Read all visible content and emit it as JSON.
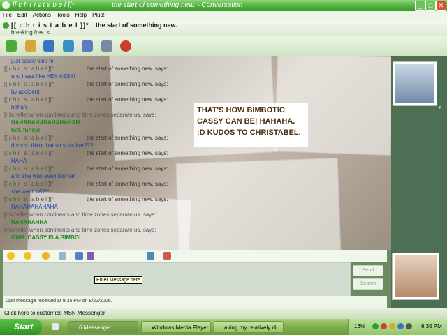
{
  "window": {
    "title_name": "[[ c h r i s t a b e l ]]*",
    "title_conv": "the start of something new. - Conversation",
    "controls": [
      "_",
      "□",
      "✕"
    ]
  },
  "menu": [
    "File",
    "Edit",
    "Actions",
    "Tools",
    "Help",
    "Plus!"
  ],
  "header": {
    "name": "[[ c h r i s t a b e l ]]*",
    "name_suffix": "the start of something new.",
    "personal_message": "breaking free. <"
  },
  "toolbar_icons": [
    "invite-icon",
    "send-files-icon",
    "webcam-icon",
    "call-icon",
    "activities-icon",
    "games-icon",
    "block-icon"
  ],
  "chat": [
    {
      "type": "msg",
      "text": "just cassy said hi"
    },
    {
      "type": "who",
      "text": "[[ c h r i s t a b e l ]]*",
      "says": "the start of something new. says:"
    },
    {
      "type": "msg",
      "text": "and i was like HEY ASSY!"
    },
    {
      "type": "who",
      "text": "[[ c h r i s t a b e l ]]*",
      "says": "the start of something new. says:"
    },
    {
      "type": "msg",
      "text": "by accident"
    },
    {
      "type": "who",
      "text": "[[ c h r i s t a b e l ]]*",
      "says": "the start of something new. says:"
    },
    {
      "type": "msg",
      "text": "hahah"
    },
    {
      "type": "who",
      "text": "[michelle] when continents and time zones separate us. says:"
    },
    {
      "type": "green",
      "text": "HAHAHAHAHAHAHAHAH"
    },
    {
      "type": "green",
      "text": "fatt. funny!"
    },
    {
      "type": "who",
      "text": "[[ c h r i s t a b e l ]]*",
      "says": "the start of something new. says:"
    },
    {
      "type": "msg",
      "text": "doncho think that so suits her???"
    },
    {
      "type": "who",
      "text": "[[ c h r i s t a b e l ]]*",
      "says": "the start of something new. says:"
    },
    {
      "type": "msg",
      "text": "HAHA"
    },
    {
      "type": "who",
      "text": "[[ c h r i s t a b e l ]]*",
      "says": "the start of something new. says:"
    },
    {
      "type": "msg",
      "text": "and she was even funnier"
    },
    {
      "type": "who",
      "text": "[[ c h r i s t a b e l ]]*",
      "says": "the start of something new. says:"
    },
    {
      "type": "msg",
      "text": "she went YAYY!"
    },
    {
      "type": "who",
      "text": "[[ c h r i s t a b e l ]]*",
      "says": "the start of something new. says:"
    },
    {
      "type": "msg",
      "text": "HAHAHAHAHAHA"
    },
    {
      "type": "who",
      "text": "[michelle] when continents and time zones separate us. says:"
    },
    {
      "type": "green",
      "text": "HAHAHAHHA"
    },
    {
      "type": "who",
      "text": "[michelle] when continents and time zones separate us. says:"
    },
    {
      "type": "green",
      "text": "OMG. CASSY IS A BIMBO!"
    }
  ],
  "caption": "THAT'S HOW BIMBOTIC CASSY CAN BE! HAHAHA. :D KUDOS TO CHRISTABEL.",
  "input": {
    "tooltip": "Enter Message here",
    "send": "Send",
    "search": "Search",
    "format_icons": [
      "emoticon-icon",
      "wink-icon",
      "nudge-icon",
      "voice-clip-icon",
      "font-icon",
      "background-icon"
    ]
  },
  "status": "Last message received at 9:35 PM on 8/22/2006.",
  "customize": "Click here to customize MSN Messenger",
  "taskbar": {
    "start": "Start",
    "tasks": [
      {
        "label": "6 Messenger",
        "active": true
      },
      {
        "label": "Windows Media Player",
        "active": false
      },
      {
        "label": "airing my relatively di...",
        "active": false
      }
    ],
    "battery": "16%",
    "time": "9:35 PM"
  },
  "colors": {
    "accent": "#4fb03c",
    "self_text": "#1a3fb5",
    "other_text": "#1b8a1b",
    "highlight": "#c33c8a"
  }
}
